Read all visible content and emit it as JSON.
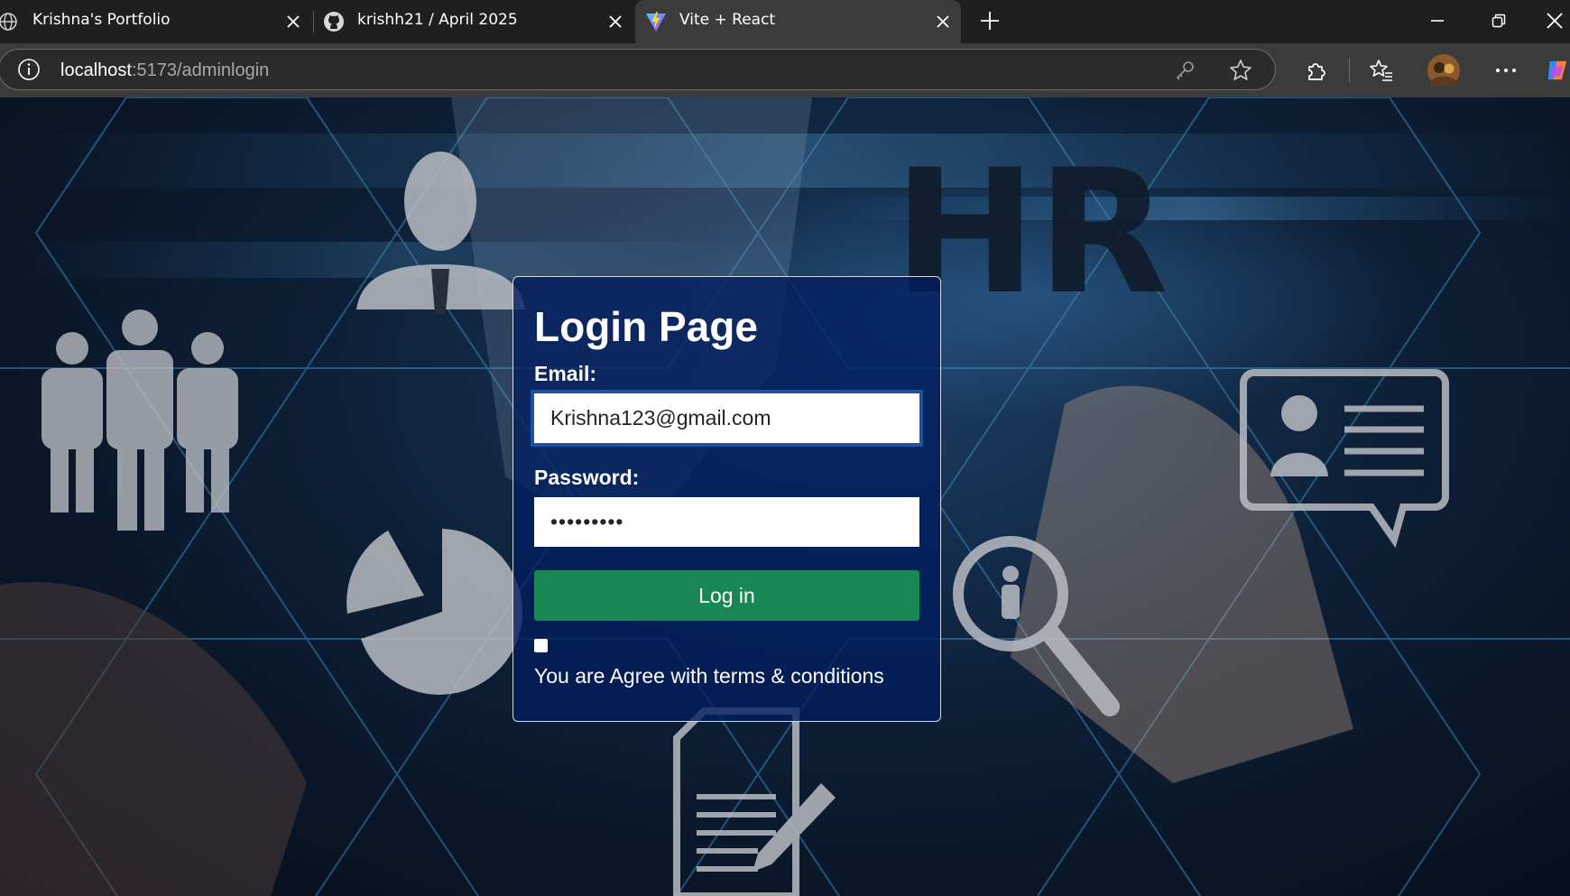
{
  "browser": {
    "tabs": [
      {
        "title": "Krishna's Portfolio",
        "icon": "globe-icon",
        "active": false
      },
      {
        "title": "krishh21 / April 2025",
        "icon": "github-icon",
        "active": false
      },
      {
        "title": "Vite + React",
        "icon": "vite-icon",
        "active": true
      }
    ],
    "new_tab_label": "+",
    "url_host": "localhost",
    "url_path": ":5173/adminlogin"
  },
  "background": {
    "watermark_text": "HR"
  },
  "login": {
    "title": "Login Page",
    "email_label": "Email:",
    "email_value": "Krishna123@gmail.com",
    "password_label": "Password:",
    "password_value": "•••••••••",
    "login_button": "Log in",
    "terms_checked": false,
    "terms_text": "You are Agree with terms & conditions"
  },
  "colors": {
    "login_button": "#198754",
    "card_background": "#031e5f",
    "page_background": "#0d1f36"
  }
}
